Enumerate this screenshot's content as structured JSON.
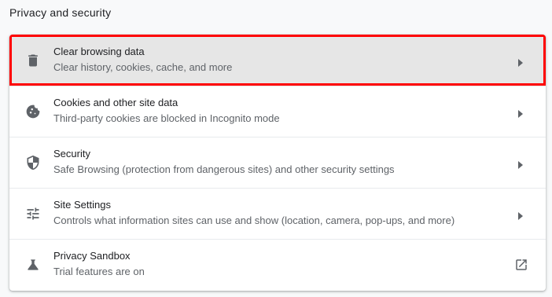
{
  "section": {
    "title": "Privacy and security"
  },
  "colors": {
    "highlight_outline": "#ff0000",
    "highlight_bg": "#e6e6e6",
    "icon": "#5f6368",
    "title_text": "#202124",
    "subtitle_text": "#5f6368"
  },
  "items": [
    {
      "icon": "trash-icon",
      "title": "Clear browsing data",
      "subtitle": "Clear history, cookies, cache, and more",
      "trailing": "chevron-right-icon"
    },
    {
      "icon": "cookie-icon",
      "title": "Cookies and other site data",
      "subtitle": "Third-party cookies are blocked in Incognito mode",
      "trailing": "chevron-right-icon"
    },
    {
      "icon": "shield-icon",
      "title": "Security",
      "subtitle": "Safe Browsing (protection from dangerous sites) and other security settings",
      "trailing": "chevron-right-icon"
    },
    {
      "icon": "tune-icon",
      "title": "Site Settings",
      "subtitle": "Controls what information sites can use and show (location, camera, pop-ups, and more)",
      "trailing": "chevron-right-icon"
    },
    {
      "icon": "flask-icon",
      "title": "Privacy Sandbox",
      "subtitle": "Trial features are on",
      "trailing": "open-in-new-icon"
    }
  ]
}
